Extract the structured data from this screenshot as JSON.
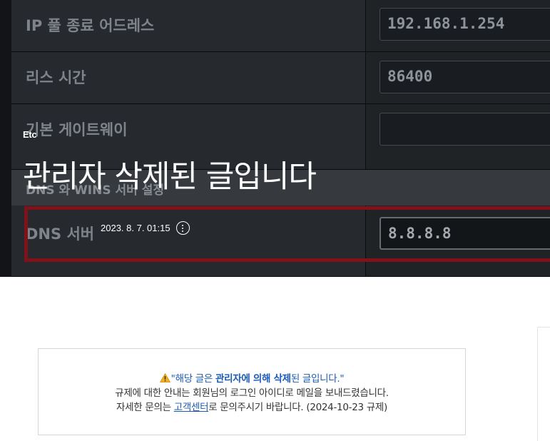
{
  "background": {
    "rows": [
      {
        "label": "IP 풀 종료 어드레스",
        "value": "192.168.1.254"
      },
      {
        "label": "리스 시간",
        "value": "86400"
      },
      {
        "label": "기본 게이트웨이",
        "value": ""
      }
    ],
    "section_label": "DNS 와 WINS 서버 설정",
    "dns_label": "DNS 서버",
    "dns_value": "8.8.8.8"
  },
  "post": {
    "category": "Etc",
    "title": "관리자 삭제된 글입니다",
    "date": "2023. 8. 7. 01:15"
  },
  "notice": {
    "line1_open_quote": "\"",
    "line1_pre": "해당 글은 ",
    "line1_emphasis": "관리자에 의해 삭제",
    "line1_post": "된 글입니다.",
    "line1_close_quote": "\"",
    "line2": "규제에 대한 안내는 회원님의 로그인 아이디로 메일을 보내드렸습니다.",
    "line3_pre": "자세한 문의는 ",
    "line3_link": "고객센터",
    "line3_post": "로 문의주시기 바랍니다. (2024-10-23 규제)"
  },
  "colors": {
    "accent_blue": "#1b5bb8",
    "frame_red": "#8a141d",
    "warning_yellow": "#f2b01e"
  }
}
